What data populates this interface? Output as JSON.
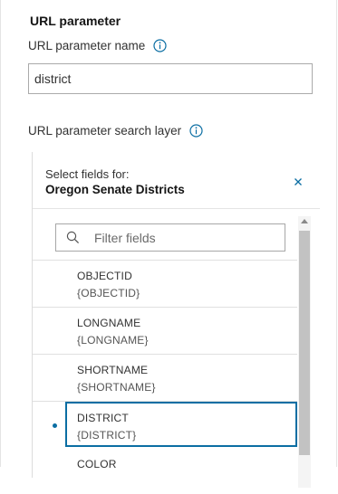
{
  "url_parameter": {
    "section_title": "URL parameter",
    "name_label": "URL parameter name",
    "name_value": "district",
    "search_layer_label": "URL parameter search layer"
  },
  "field_picker": {
    "header_label": "Select fields for:",
    "layer_name": "Oregon Senate Districts",
    "close_icon": "close-icon",
    "filter_placeholder": "Filter fields",
    "fields": [
      {
        "name": "OBJECTID",
        "token": "{OBJECTID}",
        "selected": false
      },
      {
        "name": "LONGNAME",
        "token": "{LONGNAME}",
        "selected": false
      },
      {
        "name": "SHORTNAME",
        "token": "{SHORTNAME}",
        "selected": false
      },
      {
        "name": "DISTRICT",
        "token": "{DISTRICT}",
        "selected": true
      },
      {
        "name": "COLOR",
        "token": "",
        "selected": false
      }
    ]
  },
  "colors": {
    "accent": "#0b6ea3",
    "info_icon": "#0b6ea3",
    "text": "#323232"
  }
}
